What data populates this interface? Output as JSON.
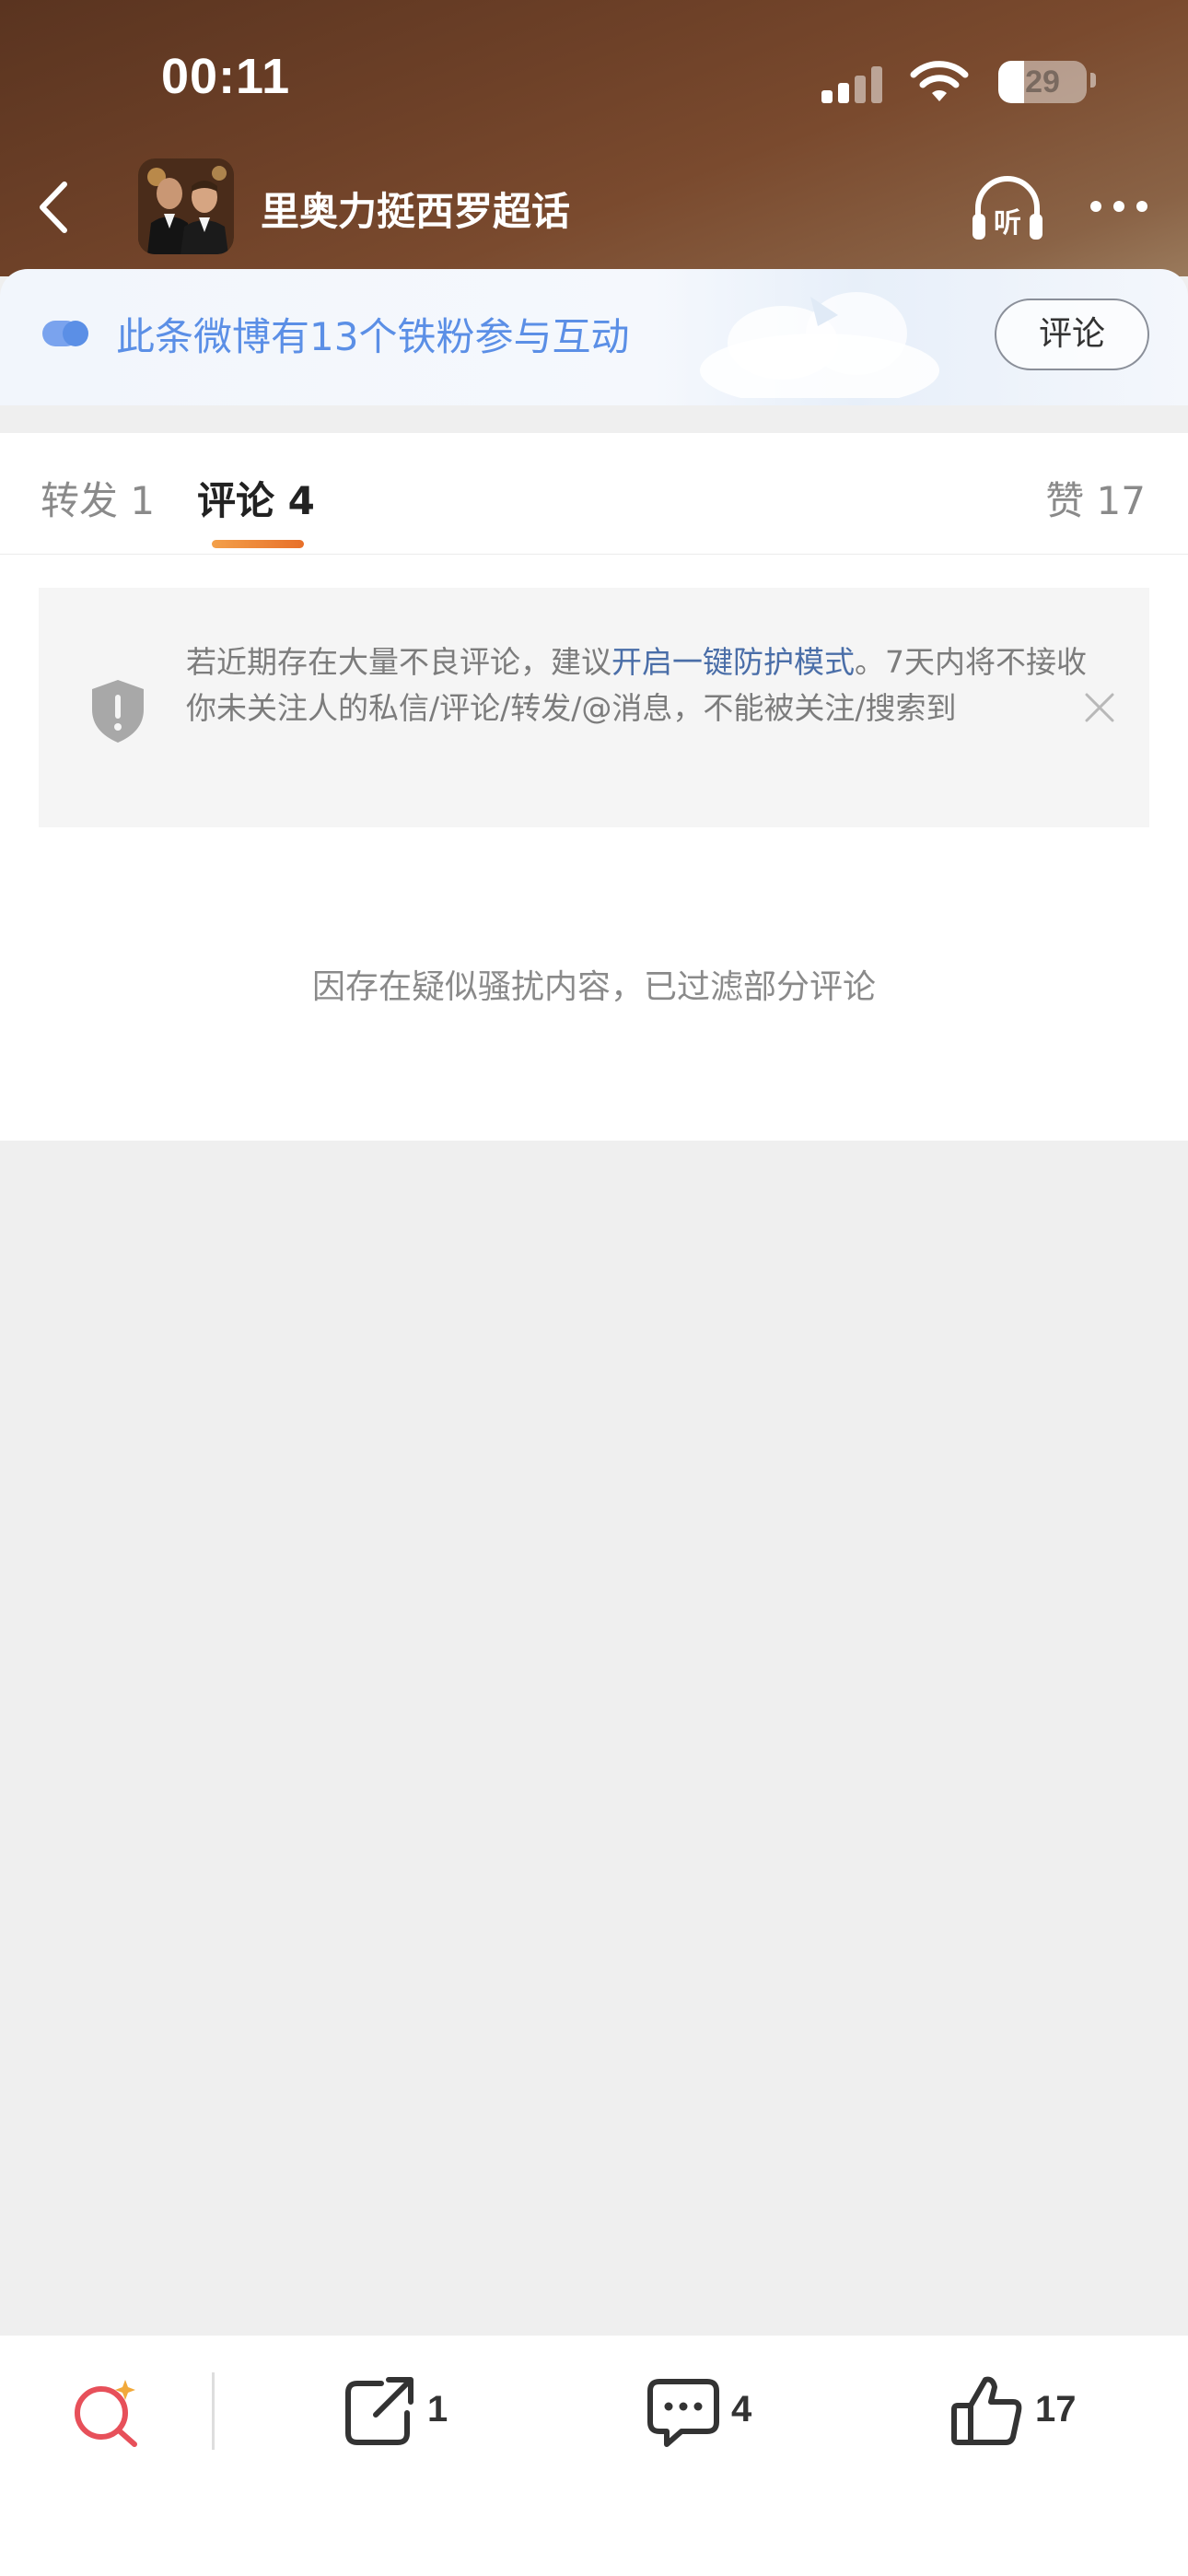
{
  "status_bar": {
    "time": "00:11",
    "battery": "29",
    "battery_level": 0.29
  },
  "header": {
    "title": "里奥力挺西罗超话"
  },
  "fan_banner": {
    "text": "此条微博有13个铁粉参与互动",
    "button": "评论"
  },
  "tabs": {
    "forward": "转发 1",
    "comment": "评论 4",
    "like": "赞 17"
  },
  "protect_notice": {
    "text_before": "若近期存在大量不良评论，建议",
    "link": "开启一键防护模式",
    "text_after": "。7天内将不接收你未关注人的私信/评论/转发/@消息，不能被关注/搜索到"
  },
  "filtered_note": "因存在疑似骚扰内容，已过滤部分评论",
  "toolbar": {
    "forward_count": "1",
    "comment_count": "4",
    "like_count": "17"
  },
  "colors": {
    "accent_blue": "#5b8fe6",
    "tab_underline": "#ee7f2e",
    "link_blue": "#4a6ea8",
    "search_red": "#e7505a",
    "search_star": "#f2a93b"
  },
  "icons": {
    "back": "chevron-left-icon",
    "listen": "headphones-listen-icon",
    "more": "more-dots-icon",
    "fan": "fan-badge-icon",
    "shield": "shield-alert-icon",
    "close": "close-icon",
    "search": "ai-search-icon",
    "forward": "share-out-icon",
    "comment": "comment-bubble-icon",
    "like": "thumbs-up-icon"
  }
}
